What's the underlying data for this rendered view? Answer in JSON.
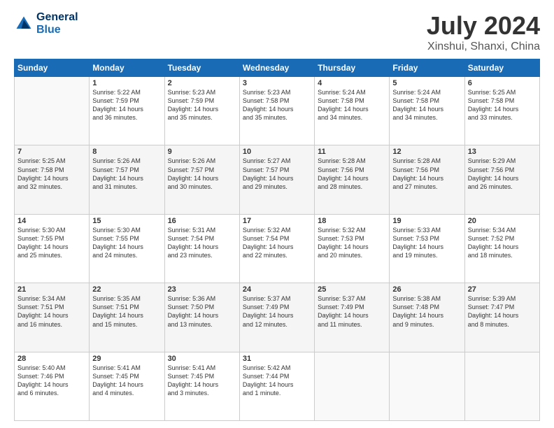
{
  "header": {
    "logo_line1": "General",
    "logo_line2": "Blue",
    "title": "July 2024",
    "subtitle": "Xinshui, Shanxi, China"
  },
  "weekdays": [
    "Sunday",
    "Monday",
    "Tuesday",
    "Wednesday",
    "Thursday",
    "Friday",
    "Saturday"
  ],
  "weeks": [
    [
      {
        "day": "",
        "sunrise": "",
        "sunset": "",
        "daylight": "",
        "empty": true
      },
      {
        "day": "1",
        "sunrise": "5:22 AM",
        "sunset": "7:59 PM",
        "daylight": "14 hours and 36 minutes."
      },
      {
        "day": "2",
        "sunrise": "5:23 AM",
        "sunset": "7:59 PM",
        "daylight": "14 hours and 35 minutes."
      },
      {
        "day": "3",
        "sunrise": "5:23 AM",
        "sunset": "7:58 PM",
        "daylight": "14 hours and 35 minutes."
      },
      {
        "day": "4",
        "sunrise": "5:24 AM",
        "sunset": "7:58 PM",
        "daylight": "14 hours and 34 minutes."
      },
      {
        "day": "5",
        "sunrise": "5:24 AM",
        "sunset": "7:58 PM",
        "daylight": "14 hours and 34 minutes."
      },
      {
        "day": "6",
        "sunrise": "5:25 AM",
        "sunset": "7:58 PM",
        "daylight": "14 hours and 33 minutes."
      }
    ],
    [
      {
        "day": "7",
        "sunrise": "5:25 AM",
        "sunset": "7:58 PM",
        "daylight": "14 hours and 32 minutes."
      },
      {
        "day": "8",
        "sunrise": "5:26 AM",
        "sunset": "7:57 PM",
        "daylight": "14 hours and 31 minutes."
      },
      {
        "day": "9",
        "sunrise": "5:26 AM",
        "sunset": "7:57 PM",
        "daylight": "14 hours and 30 minutes."
      },
      {
        "day": "10",
        "sunrise": "5:27 AM",
        "sunset": "7:57 PM",
        "daylight": "14 hours and 29 minutes."
      },
      {
        "day": "11",
        "sunrise": "5:28 AM",
        "sunset": "7:56 PM",
        "daylight": "14 hours and 28 minutes."
      },
      {
        "day": "12",
        "sunrise": "5:28 AM",
        "sunset": "7:56 PM",
        "daylight": "14 hours and 27 minutes."
      },
      {
        "day": "13",
        "sunrise": "5:29 AM",
        "sunset": "7:56 PM",
        "daylight": "14 hours and 26 minutes."
      }
    ],
    [
      {
        "day": "14",
        "sunrise": "5:30 AM",
        "sunset": "7:55 PM",
        "daylight": "14 hours and 25 minutes."
      },
      {
        "day": "15",
        "sunrise": "5:30 AM",
        "sunset": "7:55 PM",
        "daylight": "14 hours and 24 minutes."
      },
      {
        "day": "16",
        "sunrise": "5:31 AM",
        "sunset": "7:54 PM",
        "daylight": "14 hours and 23 minutes."
      },
      {
        "day": "17",
        "sunrise": "5:32 AM",
        "sunset": "7:54 PM",
        "daylight": "14 hours and 22 minutes."
      },
      {
        "day": "18",
        "sunrise": "5:32 AM",
        "sunset": "7:53 PM",
        "daylight": "14 hours and 20 minutes."
      },
      {
        "day": "19",
        "sunrise": "5:33 AM",
        "sunset": "7:53 PM",
        "daylight": "14 hours and 19 minutes."
      },
      {
        "day": "20",
        "sunrise": "5:34 AM",
        "sunset": "7:52 PM",
        "daylight": "14 hours and 18 minutes."
      }
    ],
    [
      {
        "day": "21",
        "sunrise": "5:34 AM",
        "sunset": "7:51 PM",
        "daylight": "14 hours and 16 minutes."
      },
      {
        "day": "22",
        "sunrise": "5:35 AM",
        "sunset": "7:51 PM",
        "daylight": "14 hours and 15 minutes."
      },
      {
        "day": "23",
        "sunrise": "5:36 AM",
        "sunset": "7:50 PM",
        "daylight": "14 hours and 13 minutes."
      },
      {
        "day": "24",
        "sunrise": "5:37 AM",
        "sunset": "7:49 PM",
        "daylight": "14 hours and 12 minutes."
      },
      {
        "day": "25",
        "sunrise": "5:37 AM",
        "sunset": "7:49 PM",
        "daylight": "14 hours and 11 minutes."
      },
      {
        "day": "26",
        "sunrise": "5:38 AM",
        "sunset": "7:48 PM",
        "daylight": "14 hours and 9 minutes."
      },
      {
        "day": "27",
        "sunrise": "5:39 AM",
        "sunset": "7:47 PM",
        "daylight": "14 hours and 8 minutes."
      }
    ],
    [
      {
        "day": "28",
        "sunrise": "5:40 AM",
        "sunset": "7:46 PM",
        "daylight": "14 hours and 6 minutes."
      },
      {
        "day": "29",
        "sunrise": "5:41 AM",
        "sunset": "7:45 PM",
        "daylight": "14 hours and 4 minutes."
      },
      {
        "day": "30",
        "sunrise": "5:41 AM",
        "sunset": "7:45 PM",
        "daylight": "14 hours and 3 minutes."
      },
      {
        "day": "31",
        "sunrise": "5:42 AM",
        "sunset": "7:44 PM",
        "daylight": "14 hours and 1 minute."
      },
      {
        "day": "",
        "sunrise": "",
        "sunset": "",
        "daylight": "",
        "empty": true
      },
      {
        "day": "",
        "sunrise": "",
        "sunset": "",
        "daylight": "",
        "empty": true
      },
      {
        "day": "",
        "sunrise": "",
        "sunset": "",
        "daylight": "",
        "empty": true
      }
    ]
  ]
}
